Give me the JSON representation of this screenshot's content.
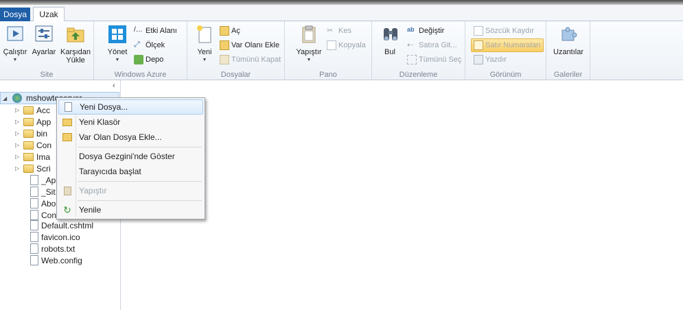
{
  "tabs": {
    "file": "Dosya",
    "active": "Uzak"
  },
  "ribbon": {
    "groups": {
      "site": {
        "label": "Site",
        "run": "Çalıştır",
        "settings": "Ayarlar",
        "upload_line1": "Karşıdan",
        "upload_line2": "Yükle"
      },
      "azure": {
        "label": "Windows Azure",
        "manage": "Yönet",
        "traffic": "Etki Alanı",
        "scale": "Ölçek",
        "storage": "Depo"
      },
      "files": {
        "label": "Dosyalar",
        "new": "Yeni",
        "open": "Aç",
        "add_existing": "Var Olanı Ekle",
        "close_all": "Tümünü Kapat"
      },
      "clipboard": {
        "label": "Pano",
        "paste": "Yapıştır",
        "cut": "Kes",
        "copy": "Kopyala"
      },
      "editing": {
        "label": "Düzenleme",
        "find": "Bul",
        "replace": "Değiştir",
        "goto_line": "Satıra Git...",
        "select_all": "Tümünü Seç"
      },
      "view": {
        "label": "Görünüm",
        "word_wrap": "Sözcük Kaydır",
        "line_numbers": "Satır Numaraları",
        "print": "Yazdır"
      },
      "galleries": {
        "label": "Galeriler",
        "extensions": "Uzantılar"
      }
    }
  },
  "tree": {
    "root": "mshowtoserver",
    "folders": [
      "Acc",
      "App",
      "bin",
      "Con",
      "Ima",
      "Scri"
    ],
    "files": [
      "_Ap",
      "_Sit",
      "Abo",
      "Con",
      "Default.cshtml",
      "favicon.ico",
      "robots.txt",
      "Web.config"
    ]
  },
  "context_menu": {
    "new_file": "Yeni Dosya...",
    "new_folder": "Yeni Klasör",
    "add_existing_file": "Var Olan Dosya Ekle...",
    "show_in_explorer": "Dosya Gezgini'nde Göster",
    "launch_in_browser": "Tarayıcıda başlat",
    "paste": "Yapıştır",
    "refresh": "Yenile"
  },
  "colors": {
    "file_tab": "#1f5fa8",
    "highlight": "#f8cf64",
    "selection": "#dcebfc"
  }
}
